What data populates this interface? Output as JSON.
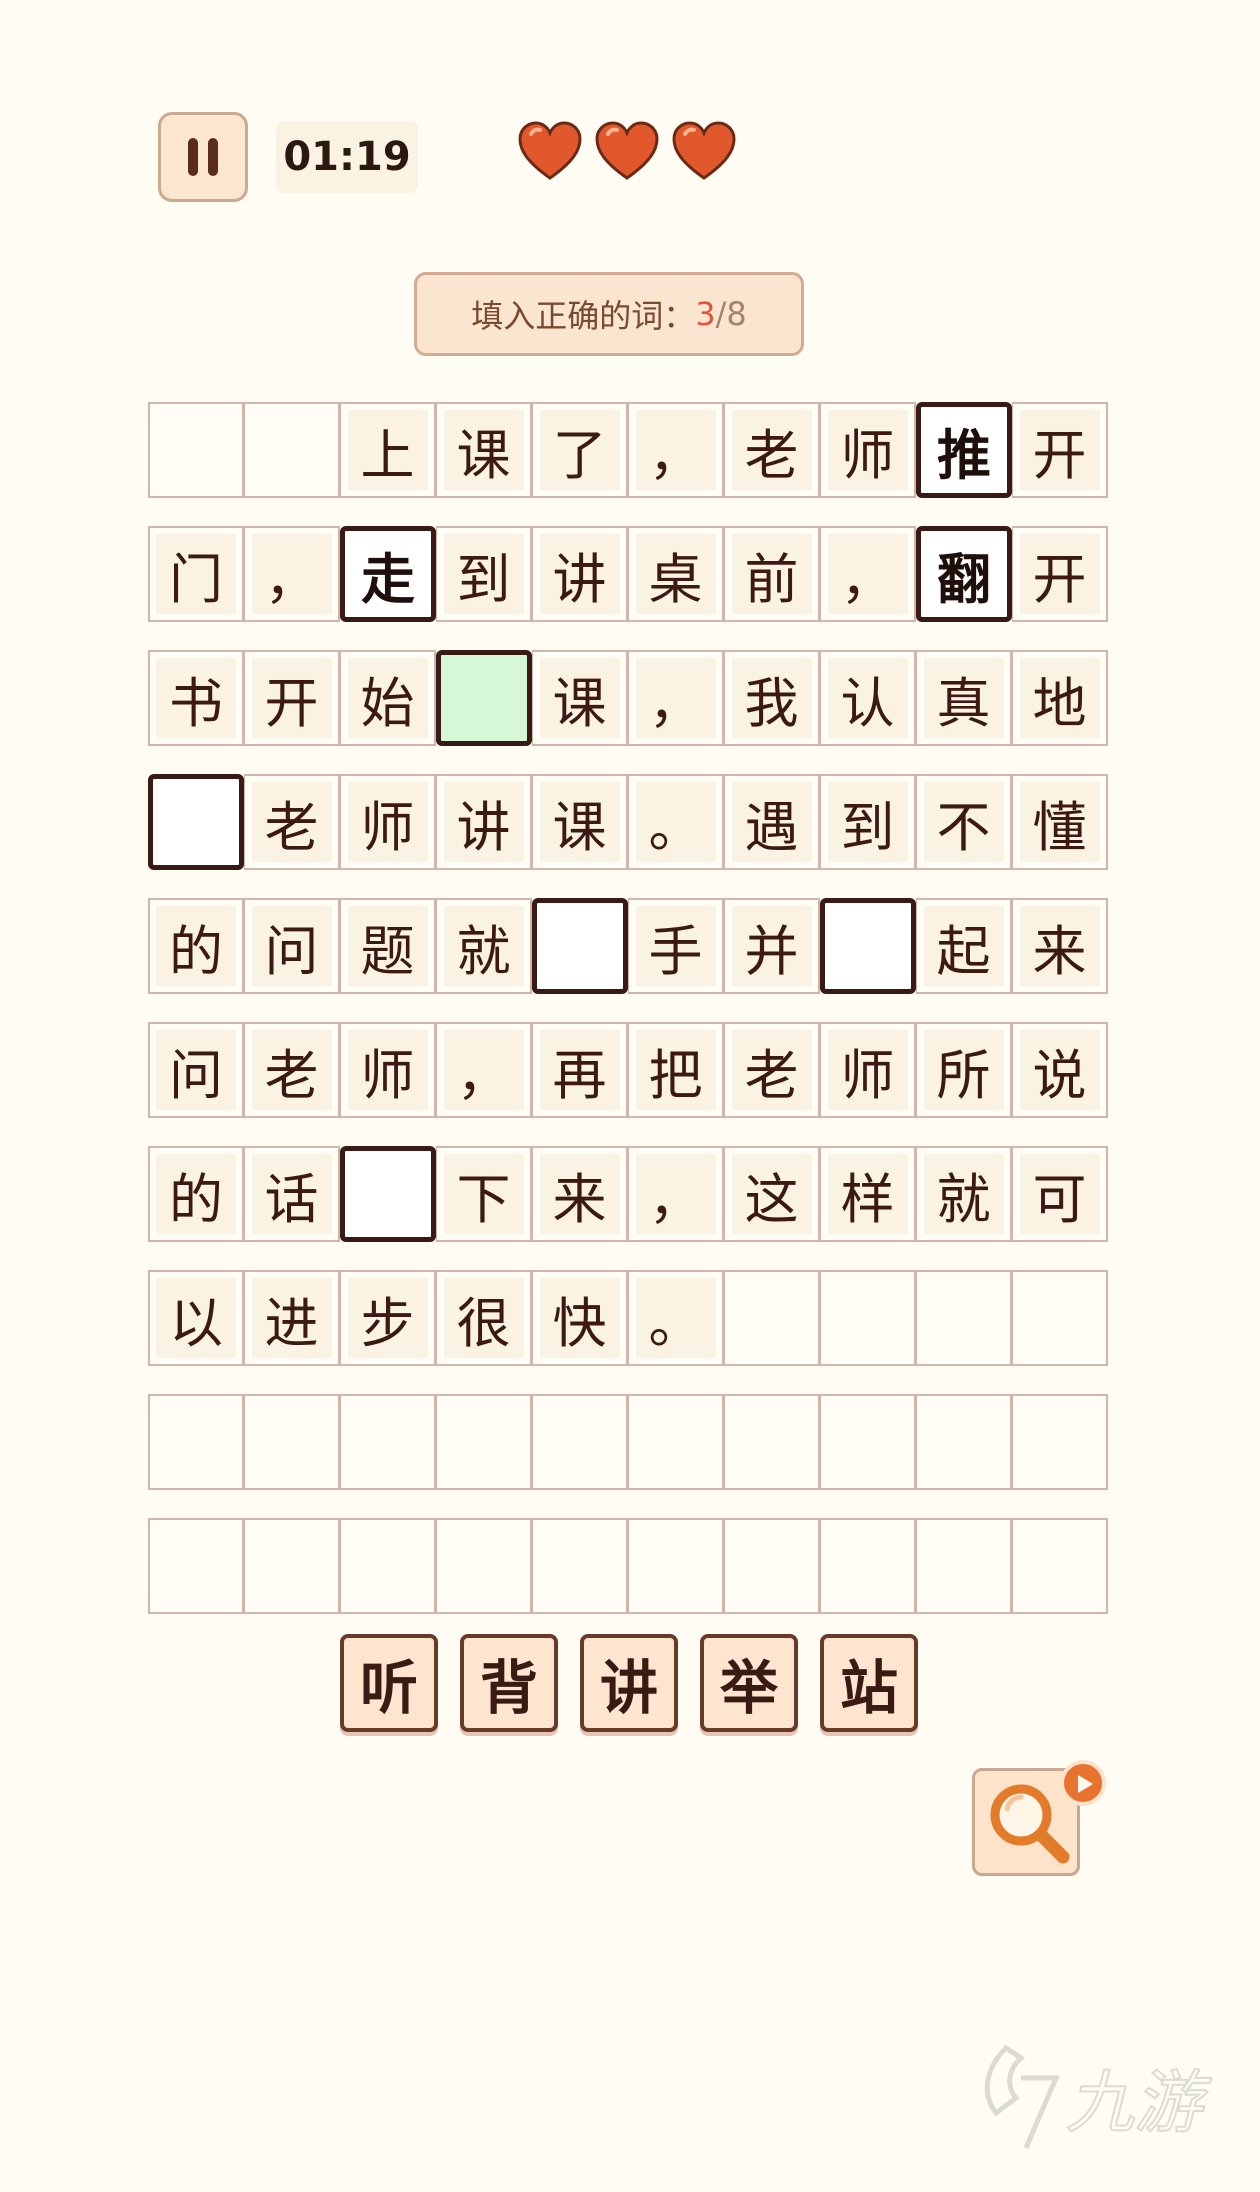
{
  "header": {
    "pause_icon": "pause-icon",
    "timer": "01:19",
    "lives": 3,
    "heart_color": "#e0582c"
  },
  "progress": {
    "label": "填入正确的词：",
    "current": "3",
    "slash": "/",
    "total": "8"
  },
  "grid": {
    "rows": [
      [
        {
          "c": "",
          "t": "empty"
        },
        {
          "c": "",
          "t": "empty"
        },
        {
          "c": "上",
          "t": "text"
        },
        {
          "c": "课",
          "t": "text"
        },
        {
          "c": "了",
          "t": "text"
        },
        {
          "c": "，",
          "t": "text"
        },
        {
          "c": "老",
          "t": "text"
        },
        {
          "c": "师",
          "t": "text"
        },
        {
          "c": "推",
          "t": "filled"
        },
        {
          "c": "开",
          "t": "text"
        }
      ],
      [
        {
          "c": "门",
          "t": "text"
        },
        {
          "c": "，",
          "t": "text"
        },
        {
          "c": "走",
          "t": "filled"
        },
        {
          "c": "到",
          "t": "text"
        },
        {
          "c": "讲",
          "t": "text"
        },
        {
          "c": "桌",
          "t": "text"
        },
        {
          "c": "前",
          "t": "text"
        },
        {
          "c": "，",
          "t": "text"
        },
        {
          "c": "翻",
          "t": "filled"
        },
        {
          "c": "开",
          "t": "text"
        }
      ],
      [
        {
          "c": "书",
          "t": "text"
        },
        {
          "c": "开",
          "t": "text"
        },
        {
          "c": "始",
          "t": "text"
        },
        {
          "c": "",
          "t": "active"
        },
        {
          "c": "课",
          "t": "text"
        },
        {
          "c": "，",
          "t": "text"
        },
        {
          "c": "我",
          "t": "text"
        },
        {
          "c": "认",
          "t": "text"
        },
        {
          "c": "真",
          "t": "text"
        },
        {
          "c": "地",
          "t": "text"
        }
      ],
      [
        {
          "c": "",
          "t": "blank"
        },
        {
          "c": "老",
          "t": "text"
        },
        {
          "c": "师",
          "t": "text"
        },
        {
          "c": "讲",
          "t": "text"
        },
        {
          "c": "课",
          "t": "text"
        },
        {
          "c": "。",
          "t": "text"
        },
        {
          "c": "遇",
          "t": "text"
        },
        {
          "c": "到",
          "t": "text"
        },
        {
          "c": "不",
          "t": "text"
        },
        {
          "c": "懂",
          "t": "text"
        }
      ],
      [
        {
          "c": "的",
          "t": "text"
        },
        {
          "c": "问",
          "t": "text"
        },
        {
          "c": "题",
          "t": "text"
        },
        {
          "c": "就",
          "t": "text"
        },
        {
          "c": "",
          "t": "blank"
        },
        {
          "c": "手",
          "t": "text"
        },
        {
          "c": "并",
          "t": "text"
        },
        {
          "c": "",
          "t": "blank"
        },
        {
          "c": "起",
          "t": "text"
        },
        {
          "c": "来",
          "t": "text"
        }
      ],
      [
        {
          "c": "问",
          "t": "text"
        },
        {
          "c": "老",
          "t": "text"
        },
        {
          "c": "师",
          "t": "text"
        },
        {
          "c": "，",
          "t": "text"
        },
        {
          "c": "再",
          "t": "text"
        },
        {
          "c": "把",
          "t": "text"
        },
        {
          "c": "老",
          "t": "text"
        },
        {
          "c": "师",
          "t": "text"
        },
        {
          "c": "所",
          "t": "text"
        },
        {
          "c": "说",
          "t": "text"
        }
      ],
      [
        {
          "c": "的",
          "t": "text"
        },
        {
          "c": "话",
          "t": "text"
        },
        {
          "c": "",
          "t": "blank"
        },
        {
          "c": "下",
          "t": "text"
        },
        {
          "c": "来",
          "t": "text"
        },
        {
          "c": "，",
          "t": "text"
        },
        {
          "c": "这",
          "t": "text"
        },
        {
          "c": "样",
          "t": "text"
        },
        {
          "c": "就",
          "t": "text"
        },
        {
          "c": "可",
          "t": "text"
        }
      ],
      [
        {
          "c": "以",
          "t": "text"
        },
        {
          "c": "进",
          "t": "text"
        },
        {
          "c": "步",
          "t": "text"
        },
        {
          "c": "很",
          "t": "text"
        },
        {
          "c": "快",
          "t": "text"
        },
        {
          "c": "。",
          "t": "text"
        },
        {
          "c": "",
          "t": "empty"
        },
        {
          "c": "",
          "t": "empty"
        },
        {
          "c": "",
          "t": "empty"
        },
        {
          "c": "",
          "t": "empty"
        }
      ],
      [
        {
          "c": "",
          "t": "empty"
        },
        {
          "c": "",
          "t": "empty"
        },
        {
          "c": "",
          "t": "empty"
        },
        {
          "c": "",
          "t": "empty"
        },
        {
          "c": "",
          "t": "empty"
        },
        {
          "c": "",
          "t": "empty"
        },
        {
          "c": "",
          "t": "empty"
        },
        {
          "c": "",
          "t": "empty"
        },
        {
          "c": "",
          "t": "empty"
        },
        {
          "c": "",
          "t": "empty"
        }
      ],
      [
        {
          "c": "",
          "t": "empty"
        },
        {
          "c": "",
          "t": "empty"
        },
        {
          "c": "",
          "t": "empty"
        },
        {
          "c": "",
          "t": "empty"
        },
        {
          "c": "",
          "t": "empty"
        },
        {
          "c": "",
          "t": "empty"
        },
        {
          "c": "",
          "t": "empty"
        },
        {
          "c": "",
          "t": "empty"
        },
        {
          "c": "",
          "t": "empty"
        },
        {
          "c": "",
          "t": "empty"
        }
      ]
    ]
  },
  "choices": [
    "听",
    "背",
    "讲",
    "举",
    "站"
  ],
  "hint": {
    "icon": "magnifier-icon",
    "badge_icon": "play-icon"
  },
  "watermark": {
    "icon": "jiuyou-logo-icon",
    "text": "九游"
  }
}
